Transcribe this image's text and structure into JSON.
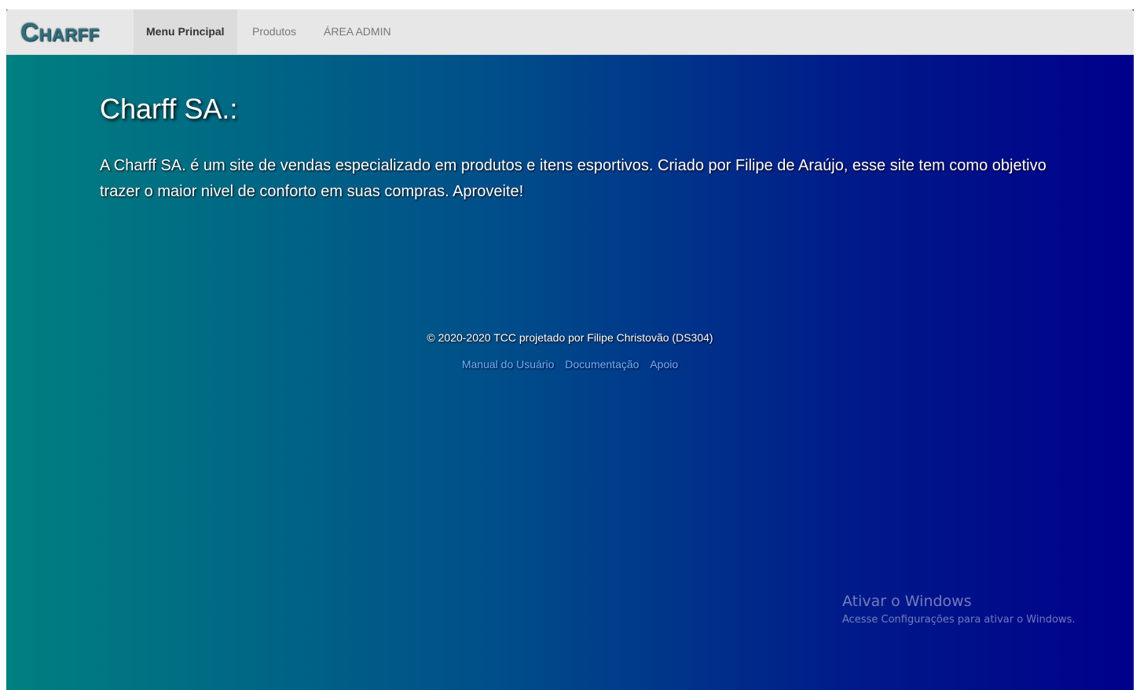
{
  "navbar": {
    "brand": "Charff",
    "items": [
      {
        "label": "Menu Principal",
        "active": true
      },
      {
        "label": "Produtos",
        "active": false
      },
      {
        "label": "ÁREA ADMIN",
        "active": false
      }
    ]
  },
  "main": {
    "heading": "Charff SA.:",
    "intro": "A Charff SA. é um site de vendas especializado em produtos e itens esportivos. Criado por Filipe de Araújo, esse site tem como objetivo trazer o maior nivel de conforto em suas compras. Aproveite!"
  },
  "footer": {
    "copyright": "© 2020-2020 TCC projetado por Filipe Christovão (DS304)",
    "links": [
      "Manual do Usuário",
      "Documentação",
      "Apoio"
    ]
  },
  "watermark": {
    "title": "Ativar o Windows",
    "subtitle": "Acesse Configurações para ativar o Windows."
  },
  "colors": {
    "gradient_start": "#008080",
    "gradient_end": "#00008b",
    "navbar_bg": "#e7e7e7",
    "link": "#6fb3ff"
  }
}
